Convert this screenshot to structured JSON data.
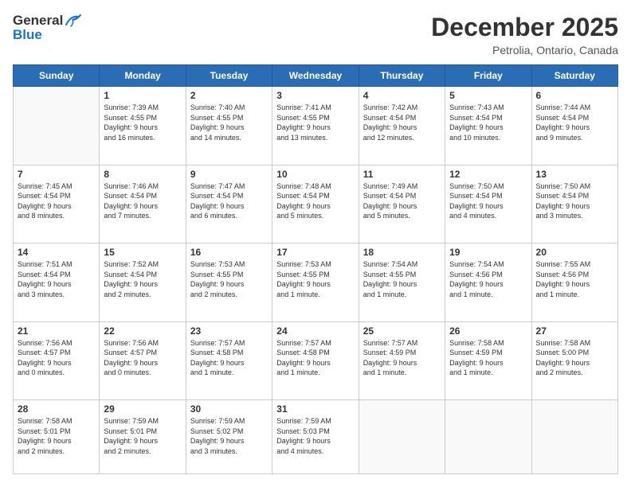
{
  "logo": {
    "line1": "General",
    "line2": "Blue"
  },
  "title": "December 2025",
  "location": "Petrolia, Ontario, Canada",
  "days_header": [
    "Sunday",
    "Monday",
    "Tuesday",
    "Wednesday",
    "Thursday",
    "Friday",
    "Saturday"
  ],
  "weeks": [
    [
      {
        "day": "",
        "info": ""
      },
      {
        "day": "1",
        "info": "Sunrise: 7:39 AM\nSunset: 4:55 PM\nDaylight: 9 hours\nand 16 minutes."
      },
      {
        "day": "2",
        "info": "Sunrise: 7:40 AM\nSunset: 4:55 PM\nDaylight: 9 hours\nand 14 minutes."
      },
      {
        "day": "3",
        "info": "Sunrise: 7:41 AM\nSunset: 4:55 PM\nDaylight: 9 hours\nand 13 minutes."
      },
      {
        "day": "4",
        "info": "Sunrise: 7:42 AM\nSunset: 4:54 PM\nDaylight: 9 hours\nand 12 minutes."
      },
      {
        "day": "5",
        "info": "Sunrise: 7:43 AM\nSunset: 4:54 PM\nDaylight: 9 hours\nand 10 minutes."
      },
      {
        "day": "6",
        "info": "Sunrise: 7:44 AM\nSunset: 4:54 PM\nDaylight: 9 hours\nand 9 minutes."
      }
    ],
    [
      {
        "day": "7",
        "info": "Sunrise: 7:45 AM\nSunset: 4:54 PM\nDaylight: 9 hours\nand 8 minutes."
      },
      {
        "day": "8",
        "info": "Sunrise: 7:46 AM\nSunset: 4:54 PM\nDaylight: 9 hours\nand 7 minutes."
      },
      {
        "day": "9",
        "info": "Sunrise: 7:47 AM\nSunset: 4:54 PM\nDaylight: 9 hours\nand 6 minutes."
      },
      {
        "day": "10",
        "info": "Sunrise: 7:48 AM\nSunset: 4:54 PM\nDaylight: 9 hours\nand 5 minutes."
      },
      {
        "day": "11",
        "info": "Sunrise: 7:49 AM\nSunset: 4:54 PM\nDaylight: 9 hours\nand 5 minutes."
      },
      {
        "day": "12",
        "info": "Sunrise: 7:50 AM\nSunset: 4:54 PM\nDaylight: 9 hours\nand 4 minutes."
      },
      {
        "day": "13",
        "info": "Sunrise: 7:50 AM\nSunset: 4:54 PM\nDaylight: 9 hours\nand 3 minutes."
      }
    ],
    [
      {
        "day": "14",
        "info": "Sunrise: 7:51 AM\nSunset: 4:54 PM\nDaylight: 9 hours\nand 3 minutes."
      },
      {
        "day": "15",
        "info": "Sunrise: 7:52 AM\nSunset: 4:54 PM\nDaylight: 9 hours\nand 2 minutes."
      },
      {
        "day": "16",
        "info": "Sunrise: 7:53 AM\nSunset: 4:55 PM\nDaylight: 9 hours\nand 2 minutes."
      },
      {
        "day": "17",
        "info": "Sunrise: 7:53 AM\nSunset: 4:55 PM\nDaylight: 9 hours\nand 1 minute."
      },
      {
        "day": "18",
        "info": "Sunrise: 7:54 AM\nSunset: 4:55 PM\nDaylight: 9 hours\nand 1 minute."
      },
      {
        "day": "19",
        "info": "Sunrise: 7:54 AM\nSunset: 4:56 PM\nDaylight: 9 hours\nand 1 minute."
      },
      {
        "day": "20",
        "info": "Sunrise: 7:55 AM\nSunset: 4:56 PM\nDaylight: 9 hours\nand 1 minute."
      }
    ],
    [
      {
        "day": "21",
        "info": "Sunrise: 7:56 AM\nSunset: 4:57 PM\nDaylight: 9 hours\nand 0 minutes."
      },
      {
        "day": "22",
        "info": "Sunrise: 7:56 AM\nSunset: 4:57 PM\nDaylight: 9 hours\nand 0 minutes."
      },
      {
        "day": "23",
        "info": "Sunrise: 7:57 AM\nSunset: 4:58 PM\nDaylight: 9 hours\nand 1 minute."
      },
      {
        "day": "24",
        "info": "Sunrise: 7:57 AM\nSunset: 4:58 PM\nDaylight: 9 hours\nand 1 minute."
      },
      {
        "day": "25",
        "info": "Sunrise: 7:57 AM\nSunset: 4:59 PM\nDaylight: 9 hours\nand 1 minute."
      },
      {
        "day": "26",
        "info": "Sunrise: 7:58 AM\nSunset: 4:59 PM\nDaylight: 9 hours\nand 1 minute."
      },
      {
        "day": "27",
        "info": "Sunrise: 7:58 AM\nSunset: 5:00 PM\nDaylight: 9 hours\nand 2 minutes."
      }
    ],
    [
      {
        "day": "28",
        "info": "Sunrise: 7:58 AM\nSunset: 5:01 PM\nDaylight: 9 hours\nand 2 minutes."
      },
      {
        "day": "29",
        "info": "Sunrise: 7:59 AM\nSunset: 5:01 PM\nDaylight: 9 hours\nand 2 minutes."
      },
      {
        "day": "30",
        "info": "Sunrise: 7:59 AM\nSunset: 5:02 PM\nDaylight: 9 hours\nand 3 minutes."
      },
      {
        "day": "31",
        "info": "Sunrise: 7:59 AM\nSunset: 5:03 PM\nDaylight: 9 hours\nand 4 minutes."
      },
      {
        "day": "",
        "info": ""
      },
      {
        "day": "",
        "info": ""
      },
      {
        "day": "",
        "info": ""
      }
    ]
  ]
}
